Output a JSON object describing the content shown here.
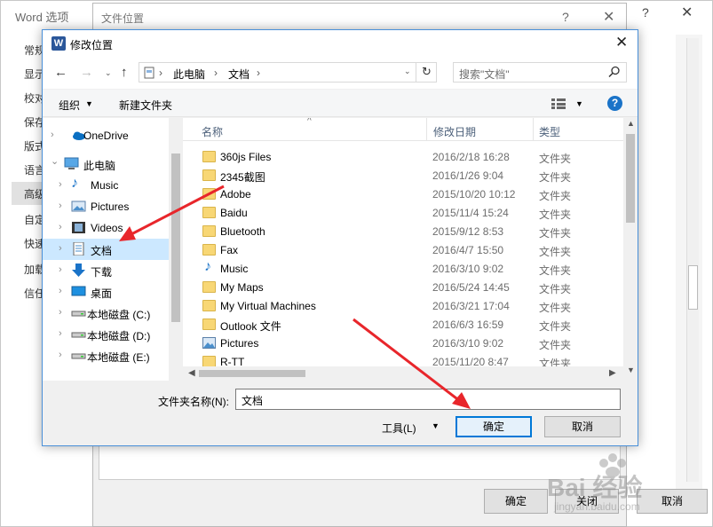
{
  "word_options": {
    "title": "Word 选项",
    "help_icon": "?",
    "close_icon": "✕",
    "nav": [
      "常规",
      "显示",
      "校对",
      "保存",
      "版式",
      "语言",
      "高级",
      "自定",
      "快速",
      "加载",
      "信任"
    ],
    "bottom_cancel": "取消"
  },
  "file_location": {
    "title": "文件位置",
    "help_icon": "?",
    "close_icon": "✕",
    "ok_label": "确定",
    "close_label": "关闭"
  },
  "modify_dialog": {
    "title": "修改位置",
    "app_icon_letter": "W",
    "close_icon": "✕",
    "breadcrumb": [
      "此电脑",
      "文档"
    ],
    "search_placeholder": "搜索\"文档\"",
    "toolbar": {
      "organize_label": "组织",
      "new_folder_label": "新建文件夹",
      "help_icon": "?"
    },
    "tree": [
      {
        "label": "OneDrive",
        "icon": "onedrive-icon",
        "expander": "›"
      },
      {
        "label": "此电脑",
        "icon": "computer-icon",
        "expander": "⌄"
      },
      {
        "label": "Music",
        "icon": "music-icon",
        "expander": "›"
      },
      {
        "label": "Pictures",
        "icon": "pictures-icon",
        "expander": "›"
      },
      {
        "label": "Videos",
        "icon": "videos-icon",
        "expander": "›"
      },
      {
        "label": "文档",
        "icon": "document-icon",
        "expander": "›",
        "selected": true
      },
      {
        "label": "下载",
        "icon": "download-icon",
        "expander": "›"
      },
      {
        "label": "桌面",
        "icon": "desktop-icon",
        "expander": "›"
      },
      {
        "label": "本地磁盘 (C:)",
        "icon": "drive-icon",
        "expander": "›"
      },
      {
        "label": "本地磁盘 (D:)",
        "icon": "drive-icon",
        "expander": "›"
      },
      {
        "label": "本地磁盘 (E:)",
        "icon": "drive-icon",
        "expander": "›"
      }
    ],
    "columns": [
      "名称",
      "修改日期",
      "类型"
    ],
    "files": [
      {
        "name": "360js Files",
        "date": "2016/2/18 16:28",
        "type": "文件夹",
        "icon": "folder-icon"
      },
      {
        "name": "2345截图",
        "date": "2016/1/26 9:04",
        "type": "文件夹",
        "icon": "folder-icon"
      },
      {
        "name": "Adobe",
        "date": "2015/10/20 10:12",
        "type": "文件夹",
        "icon": "folder-icon"
      },
      {
        "name": "Baidu",
        "date": "2015/11/4 15:24",
        "type": "文件夹",
        "icon": "folder-icon"
      },
      {
        "name": "Bluetooth",
        "date": "2015/9/12 8:53",
        "type": "文件夹",
        "icon": "folder-icon"
      },
      {
        "name": "Fax",
        "date": "2016/4/7 15:50",
        "type": "文件夹",
        "icon": "folder-icon"
      },
      {
        "name": "Music",
        "date": "2016/3/10 9:02",
        "type": "文件夹",
        "icon": "music-icon"
      },
      {
        "name": "My Maps",
        "date": "2016/5/24 14:45",
        "type": "文件夹",
        "icon": "folder-icon"
      },
      {
        "name": "My Virtual Machines",
        "date": "2016/3/21 17:04",
        "type": "文件夹",
        "icon": "folder-icon"
      },
      {
        "name": "Outlook 文件",
        "date": "2016/6/3 16:59",
        "type": "文件夹",
        "icon": "folder-icon"
      },
      {
        "name": "Pictures",
        "date": "2016/3/10 9:02",
        "type": "文件夹",
        "icon": "pictures-icon"
      },
      {
        "name": "R-TT",
        "date": "2015/11/20 8:47",
        "type": "文件夹",
        "icon": "folder-icon"
      }
    ],
    "folder_name_label": "文件夹名称(N):",
    "folder_name_value": "文档",
    "tools_label": "工具(L)",
    "ok_label": "确定",
    "cancel_label": "取消"
  },
  "watermark": {
    "logo_text": "Bai 经验",
    "url_text": "jingyan.baidu.com"
  },
  "colors": {
    "selection": "#cce8ff",
    "accent_blue": "#0078d7",
    "annotation_red": "#e8262b",
    "folder_yellow": "#f8d775"
  }
}
